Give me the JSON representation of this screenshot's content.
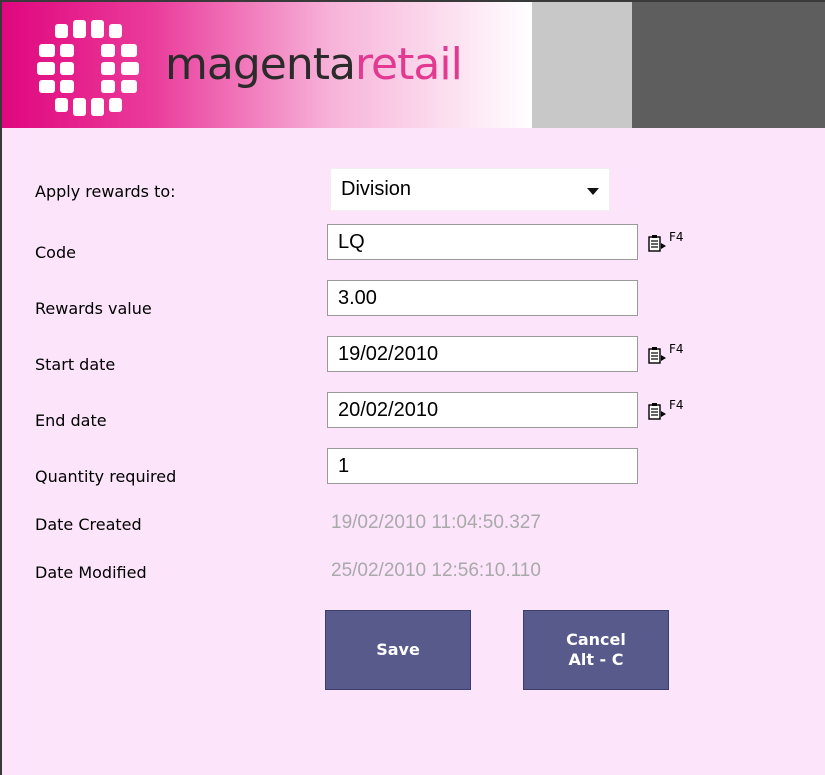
{
  "header": {
    "brand_part1": "magenta",
    "brand_part2": "retail",
    "logo_icon": "magenta-retail-logo-icon",
    "colors": {
      "brand_magenta": "#e0077e",
      "brand_text_pink": "#e23a91",
      "panel_bg": "#fce4fb",
      "button_bg": "#575a8a"
    }
  },
  "form": {
    "apply_rewards": {
      "label": "Apply rewards to:",
      "value": "Division"
    },
    "code": {
      "label": "Code",
      "value": "LQ",
      "lookup_key": "F4"
    },
    "rewards_value": {
      "label": "Rewards value",
      "value": "3.00"
    },
    "start_date": {
      "label": "Start date",
      "value": "19/02/2010",
      "lookup_key": "F4"
    },
    "end_date": {
      "label": "End date",
      "value": "20/02/2010",
      "lookup_key": "F4"
    },
    "quantity_required": {
      "label": "Quantity required",
      "value": "1"
    },
    "date_created": {
      "label": "Date Created",
      "value": "19/02/2010 11:04:50.327"
    },
    "date_modified": {
      "label": "Date Modified",
      "value": "25/02/2010 12:56:10.110"
    }
  },
  "buttons": {
    "save": "Save",
    "cancel": "Cancel\nAlt - C"
  }
}
